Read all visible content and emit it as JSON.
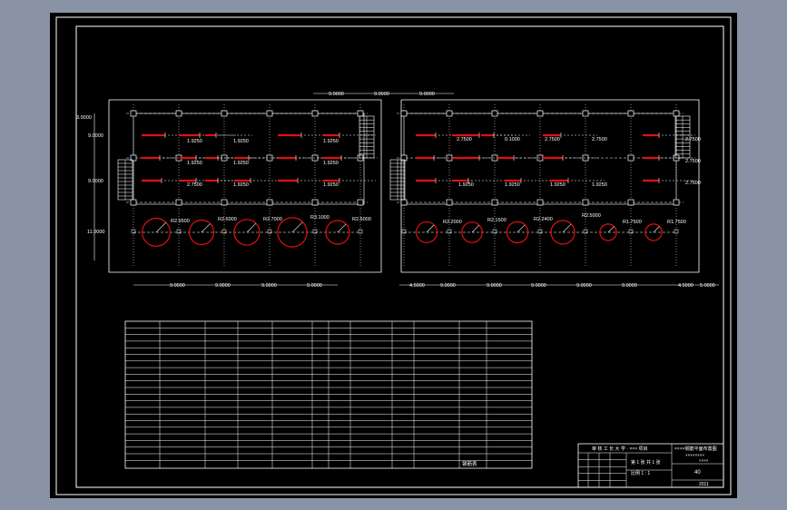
{
  "colors": {
    "backdrop": "#8a93a6",
    "sheet": "#000000",
    "line": "#ffffff",
    "accent": "#e01010"
  },
  "dims": {
    "top_spans": [
      "9.0000",
      "9.0000",
      "9.0000"
    ],
    "left_spans": [
      "3.0000",
      "9.0000",
      "9.0000",
      "11.0000"
    ],
    "bottom_left": [
      "9.0000",
      "9.0000",
      "9.0000",
      "9.0000"
    ],
    "bottom_right": [
      "4.5000",
      "9.0000",
      "9.0000",
      "9.0000",
      "9.0000",
      "9.0000",
      "4.5000",
      "5.0000"
    ]
  },
  "left_plan": {
    "row1": [
      "1.9250",
      "1.9250",
      "1.9250"
    ],
    "row2": [
      "1.9250",
      "1.9250",
      "1.9250"
    ],
    "row3": [
      "2.7500",
      "1.9250",
      "1.9250"
    ],
    "radii": [
      "R2.9500",
      "R2.6000",
      "R2.7000",
      "R3.1000",
      "R2.5000"
    ]
  },
  "right_plan": {
    "row1": [
      "2.7500",
      "0.1000",
      "2.7500",
      "2.7500",
      "2.7500"
    ],
    "row2": [
      "2.7500"
    ],
    "row3": [
      "1.9250",
      "1.9250",
      "1.9250",
      "1.9250",
      "2.7500"
    ],
    "radii": [
      "R2.2000",
      "R2.1500",
      "R2.2400",
      "R2.5000",
      "R1.7500",
      "R1.7500"
    ]
  },
  "schedule": {
    "footer_label": "钢筋表"
  },
  "title_block": {
    "header": "审 核 工 长 大 学 · ××× 项目",
    "project": "××××钢筋平面布置图",
    "sub1": "××××××××",
    "sub2": "××××",
    "sheet_no": "第 1 张 共 1 张",
    "scale": "比例  1 : 1",
    "code": "40",
    "date": "2011"
  }
}
